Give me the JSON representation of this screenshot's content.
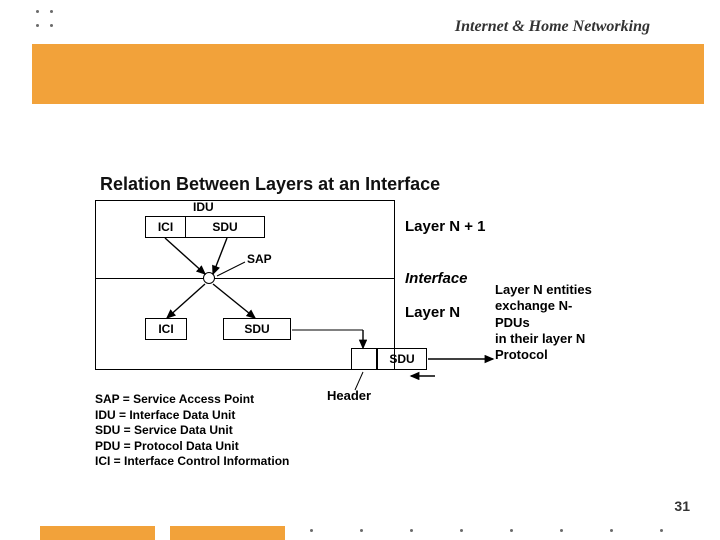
{
  "header": {
    "subject": "Internet & Home Networking"
  },
  "title": "Relation Between Layers at an Interface",
  "labels": {
    "idu": "IDU",
    "ici": "ICI",
    "sdu": "SDU",
    "sap": "SAP",
    "layer_np1": "Layer  N + 1",
    "interface": "Interface",
    "layer_n": "Layer  N",
    "header": "Header"
  },
  "side_note": {
    "l1": "Layer N entities",
    "l2": "exchange N-",
    "l3": "PDUs",
    "l4": "in their layer N",
    "l5": "Protocol"
  },
  "defs": {
    "l1": "SAP = Service Access Point",
    "l2": "IDU = Interface Data Unit",
    "l3": "SDU = Service Data Unit",
    "l4": "PDU = Protocol Data Unit",
    "l5": "ICI = Interface Control Information"
  },
  "page_no": "31"
}
